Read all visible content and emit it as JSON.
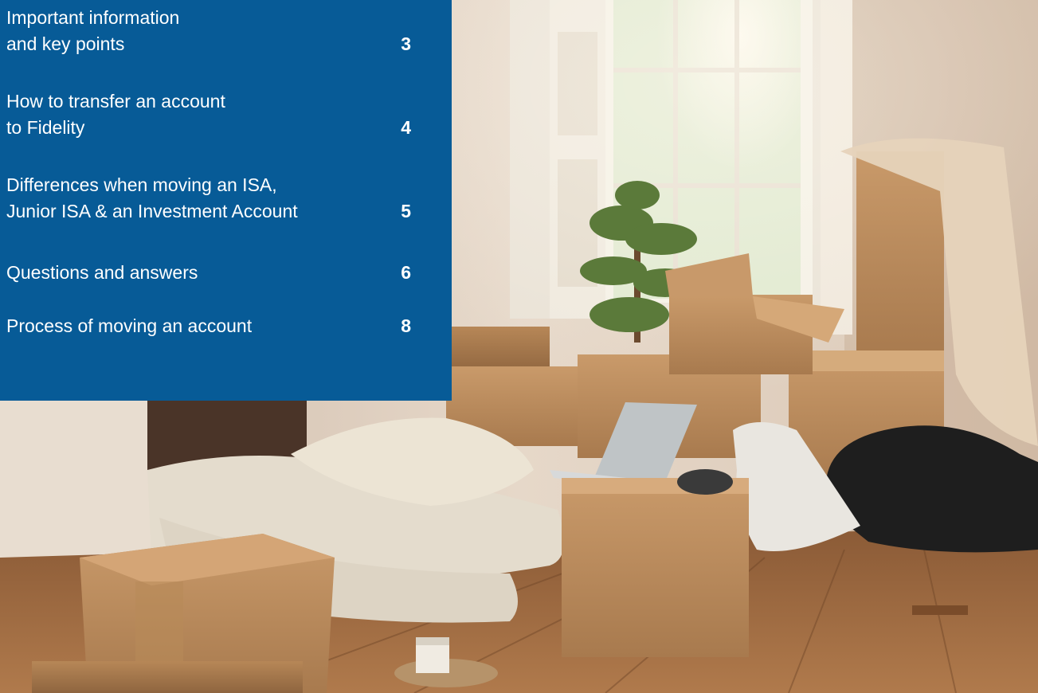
{
  "toc": {
    "items": [
      {
        "lines": [
          "Important information",
          "and key points"
        ],
        "page": "3"
      },
      {
        "lines": [
          "How to transfer an account",
          "to Fidelity"
        ],
        "page": "4"
      },
      {
        "lines": [
          "Differences when moving an ISA,",
          "Junior ISA & an Investment Account"
        ],
        "page": "5"
      },
      {
        "lines": [
          "Questions and answers"
        ],
        "page": "6"
      },
      {
        "lines": [
          "Process of moving an account"
        ],
        "page": "8"
      }
    ]
  },
  "colors": {
    "panel": "#075b97",
    "text": "#ffffff"
  },
  "image": {
    "subject": "moving-boxes-room-photo"
  }
}
